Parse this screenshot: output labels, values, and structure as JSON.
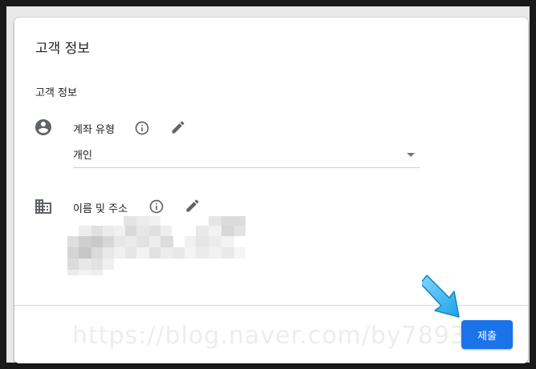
{
  "dialog": {
    "title": "고객 정보",
    "section_title": "고객 정보",
    "account_type": {
      "label": "계좌 유형",
      "value": "개인",
      "info_icon": "info-icon",
      "edit_icon": "pencil-icon"
    },
    "name_address": {
      "label": "이름 및 주소",
      "info_icon": "info-icon",
      "edit_icon": "pencil-icon"
    },
    "submit_label": "제출"
  },
  "watermark": "https://blog.naver.com/by7893",
  "colors": {
    "accent": "#1a73e8",
    "annotation_arrow": "#29b6f6"
  }
}
